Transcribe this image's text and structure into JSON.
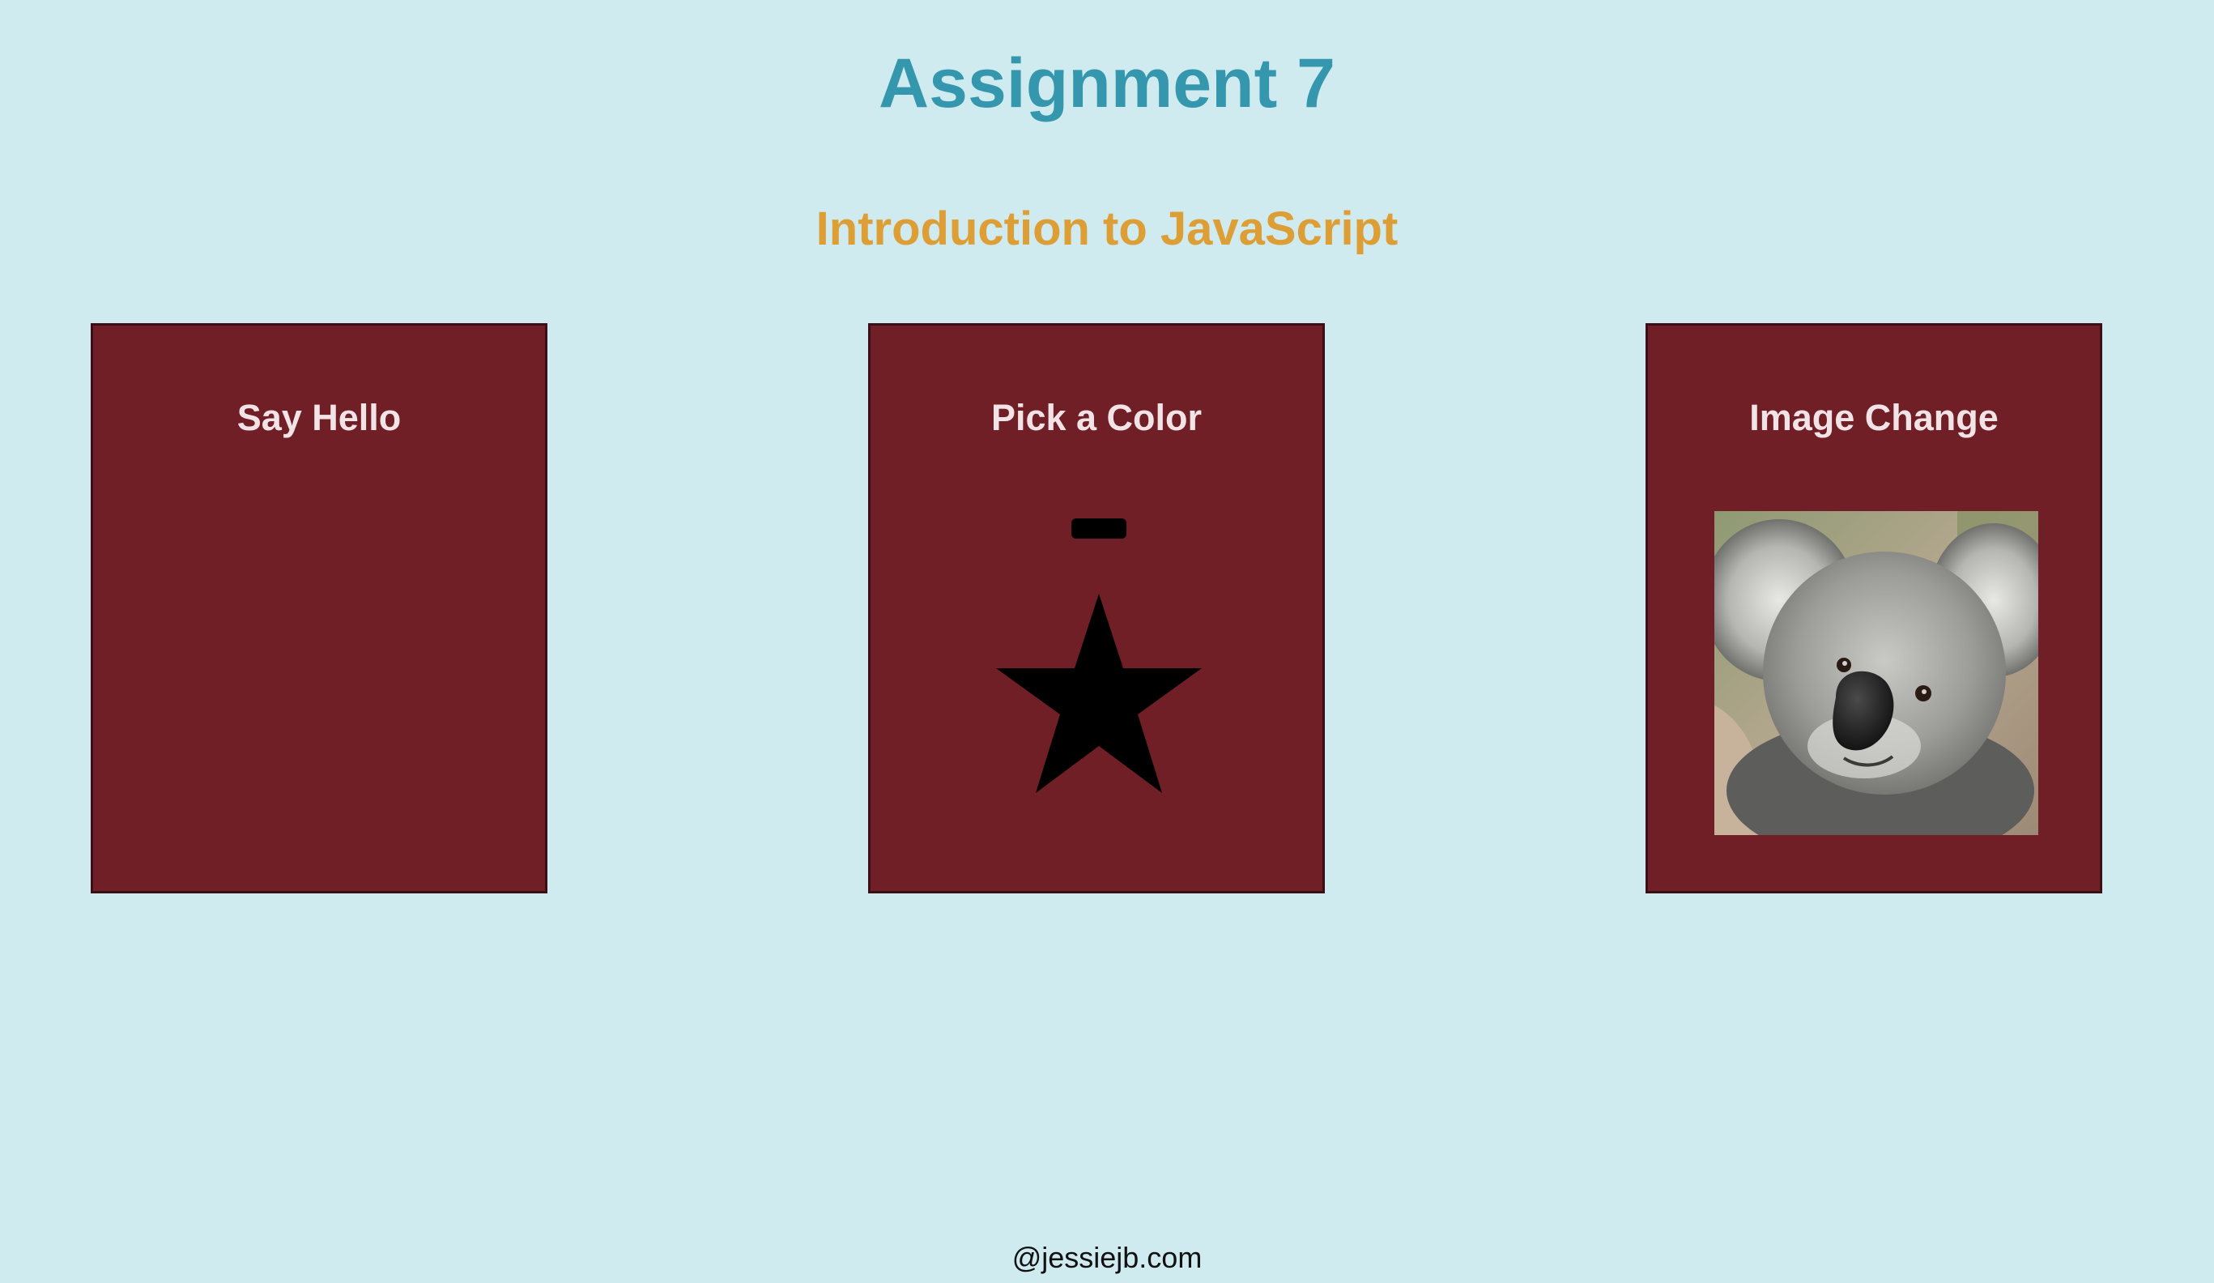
{
  "header": {
    "title": "Assignment 7",
    "subtitle": "Introduction to JavaScript"
  },
  "cards": [
    {
      "title": "Say Hello"
    },
    {
      "title": "Pick a Color",
      "picker_color": "#000000",
      "star_color": "#000000"
    },
    {
      "title": "Image Change",
      "image_subject": "koala"
    }
  ],
  "footer": {
    "text": "@jessiejb.com"
  },
  "colors": {
    "background": "#cfebef",
    "title": "#3597ad",
    "subtitle": "#dd9f35",
    "card": "#701f26",
    "card_text": "#f2e4e6"
  }
}
